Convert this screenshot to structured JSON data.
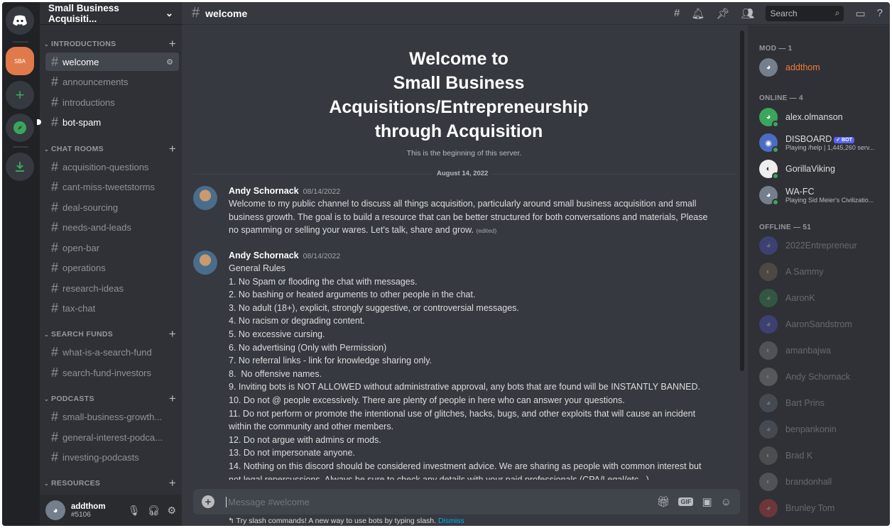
{
  "rail": {
    "home_icon": "discord-logo-icon",
    "server_label": "SBA",
    "add_icon": "+",
    "explore_icon": "compass-icon",
    "download_icon": "download-icon"
  },
  "guild": {
    "name": "Small Business Acquisiti...",
    "chevron": "⌄"
  },
  "categories": [
    {
      "name": "INTRODUCTIONS",
      "channels": [
        "welcome",
        "announcements",
        "introductions",
        "bot-spam"
      ]
    },
    {
      "name": "CHAT ROOMS",
      "channels": [
        "acquisition-questions",
        "cant-miss-tweetstorms",
        "deal-sourcing",
        "needs-and-leads",
        "open-bar",
        "operations",
        "research-ideas",
        "tax-chat"
      ]
    },
    {
      "name": "SEARCH FUNDS",
      "channels": [
        "what-is-a-search-fund",
        "search-fund-investors"
      ]
    },
    {
      "name": "PODCASTS",
      "channels": [
        "small-business-growth...",
        "general-interest-podca...",
        "investing-podcasts"
      ]
    },
    {
      "name": "RESOURCES",
      "channels": []
    }
  ],
  "user": {
    "name": "addthom",
    "discriminator": "#5106"
  },
  "topbar": {
    "channel": "welcome",
    "search_placeholder": "Search"
  },
  "welcome": {
    "title_lines": [
      "Welcome to",
      "Small Business",
      "Acquisitions/Entrepreneurship",
      "through Acquisition"
    ],
    "subtitle": "This is the beginning of this server."
  },
  "date_divider": "August 14, 2022",
  "messages": [
    {
      "author": "Andy Schornack",
      "timestamp": "08/14/2022",
      "lines": [
        "Welcome to my public channel to discuss all things acquisition, particularly around small business acquisition and small",
        "business growth.  The goal is to build a resource that can be better structured for both conversations and materials, Please",
        "no spamming or selling your wares. Let's talk, share and grow."
      ],
      "edited": "(edited)"
    },
    {
      "author": "Andy Schornack",
      "timestamp": "08/14/2022",
      "lines": [
        "General Rules",
        "1. No Spam or flooding the chat with messages.",
        "2. No bashing or heated arguments to other people in the chat.",
        "3. No adult (18+), explicit, strongly suggestive, or controversial messages.",
        "4. No racism or degrading content.",
        "5. No excessive cursing.",
        "6. No advertising (Only with Permission)",
        "7. No referral links - link for knowledge sharing only.",
        "8.  No offensive names.",
        "9. Inviting bots is NOT ALLOWED without administrative approval, any bots that are found will be INSTANTLY BANNED.",
        "10. Do not @ people excessively. There are plenty of people in here who can answer your questions.",
        "11. Do not perform or promote the intentional use of glitches, hacks, bugs, and other exploits that will cause an incident",
        "within the community and other members.",
        "12. Do not argue with admins or mods.",
        "13. Do not impersonate anyone.",
        "14. Nothing on this discord should be considered investment advice. We are sharing as people with common interest but",
        "not legal repercussions. Always be sure to check any details with your paid professionals (CPA/Legal/etc...)"
      ]
    }
  ],
  "composer": {
    "placeholder": "Message #welcome",
    "hint": "Try slash commands! A new way to use bots by typing slash.",
    "dismiss": "Dismiss",
    "gif_label": "GIF"
  },
  "members": {
    "groups": [
      {
        "label": "MOD — 1",
        "members": [
          {
            "name": "addthom",
            "activity": "",
            "bot": false
          }
        ]
      },
      {
        "label": "ONLINE — 4",
        "members": [
          {
            "name": "alex.olmanson",
            "activity": "",
            "bot": false
          },
          {
            "name": "DISBOARD",
            "activity": "Playing /help | 1,445,260 serv...",
            "bot": true
          },
          {
            "name": "GorillaViking",
            "activity": "",
            "bot": false
          },
          {
            "name": "WA-FC",
            "activity": "Playing Sid Meier's Civilizatio...",
            "bot": false
          }
        ]
      },
      {
        "label": "OFFLINE — 51",
        "members": [
          {
            "name": "2022Entrepreneur"
          },
          {
            "name": "A Sammy"
          },
          {
            "name": "AaronK"
          },
          {
            "name": "AaronSandstrom"
          },
          {
            "name": "amanbajwa"
          },
          {
            "name": "Andy Schornack"
          },
          {
            "name": "Bart Prins"
          },
          {
            "name": "benpankonin"
          },
          {
            "name": "Brad K"
          },
          {
            "name": "brandonhall"
          },
          {
            "name": "Brunley Tom"
          }
        ]
      }
    ],
    "bot_badge": "✓ BOT"
  },
  "colors": {
    "accent": "#5865f2",
    "mod": "#f47b35",
    "online": "#3ba55d",
    "link": "#00aff4"
  }
}
